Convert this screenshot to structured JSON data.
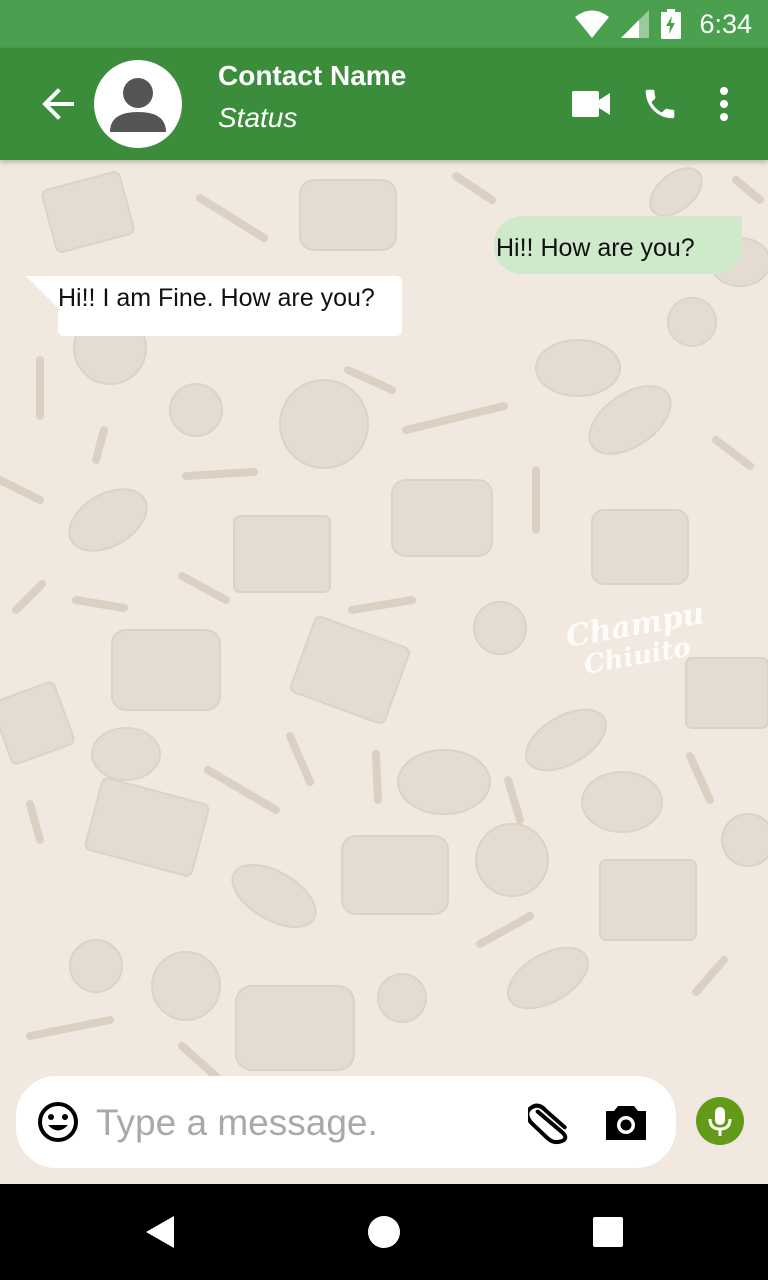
{
  "status_bar": {
    "time": "6:34",
    "icons": [
      "wifi-icon",
      "cell-signal-icon",
      "battery-charging-icon"
    ]
  },
  "header": {
    "contact_name": "Contact Name",
    "status": "Status",
    "actions": [
      "video-call-icon",
      "phone-icon",
      "more-vert-icon"
    ]
  },
  "messages": [
    {
      "direction": "outgoing",
      "text": "Hi!! How are you?"
    },
    {
      "direction": "incoming",
      "text": "Hi!! I am Fine. How are you?"
    }
  ],
  "wallpaper": {
    "watermark_line1": "Champu",
    "watermark_line2": "Chiuito"
  },
  "composer": {
    "placeholder": "Type a message.",
    "value": ""
  },
  "colors": {
    "status_bar": "#4aa04e",
    "app_bar": "#3b8d3c",
    "outgoing_bubble": "#cfe9cb",
    "incoming_bubble": "#ffffff",
    "mic_button": "#629b17",
    "chat_background": "#f1e9df"
  },
  "nav_bar": {
    "buttons": [
      "nav-back-icon",
      "nav-home-icon",
      "nav-recents-icon"
    ]
  }
}
